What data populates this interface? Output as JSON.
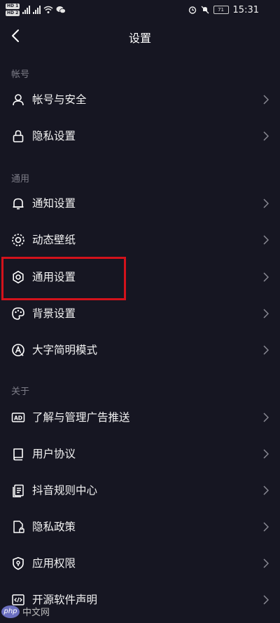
{
  "status_bar": {
    "time": "15:31",
    "battery": "71"
  },
  "header": {
    "title": "设置"
  },
  "sections": [
    {
      "label": "帐号",
      "items": [
        {
          "label": "帐号与安全",
          "icon": "user-icon"
        },
        {
          "label": "隐私设置",
          "icon": "lock-icon"
        }
      ]
    },
    {
      "label": "通用",
      "items": [
        {
          "label": "通知设置",
          "icon": "bell-icon"
        },
        {
          "label": "动态壁纸",
          "icon": "wallpaper-icon"
        },
        {
          "label": "通用设置",
          "icon": "gear-icon"
        },
        {
          "label": "背景设置",
          "icon": "palette-icon"
        },
        {
          "label": "大字简明模式",
          "icon": "large-text-icon"
        }
      ]
    },
    {
      "label": "关于",
      "items": [
        {
          "label": "了解与管理广告推送",
          "icon": "ad-icon"
        },
        {
          "label": "用户协议",
          "icon": "book-icon"
        },
        {
          "label": "抖音规则中心",
          "icon": "document-icon"
        },
        {
          "label": "隐私政策",
          "icon": "privacy-doc-icon"
        },
        {
          "label": "应用权限",
          "icon": "shield-icon"
        },
        {
          "label": "开源软件声明",
          "icon": "code-icon"
        }
      ]
    }
  ],
  "watermark": {
    "logo": "php",
    "text": "中文网"
  },
  "colors": {
    "background": "#161622",
    "highlight": "#d3121b",
    "section_label": "#7d7d88"
  }
}
